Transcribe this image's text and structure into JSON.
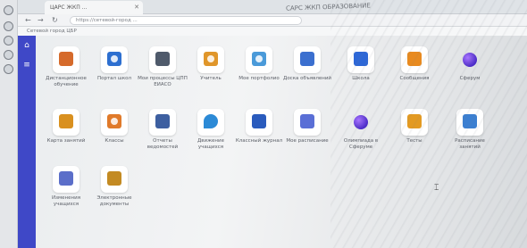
{
  "browser": {
    "tab_title": "ЦАРС ЖКП ...",
    "window_title": "САРС ЖКП ОБРАЗОВАНИЕ",
    "address": "https://сетевой-город ...",
    "bookmarks": "Сетевой город ЦБР"
  },
  "tiles": [
    {
      "label": "Дистанционное обучение",
      "color": "#d56a2b"
    },
    {
      "label": "Портал школ",
      "color": "#2d6fd0"
    },
    {
      "label": "Мои процессы ЦПП ЕИАСО",
      "color": "#4f5a6b"
    },
    {
      "label": "Учитель",
      "color": "#e0962a"
    },
    {
      "label": "Мое портфолио",
      "color": "#4a9ad9"
    },
    {
      "label": "Доска объявлений",
      "color": "#3b6fcf"
    },
    {
      "label": "Школа",
      "color": "#2d67d6"
    },
    {
      "label": "Сообщения",
      "color": "#e88a1f"
    },
    {
      "label": "Сферум",
      "color": "#6a3ad6"
    },
    {
      "label": "Карта занятий",
      "color": "#d9901f"
    },
    {
      "label": "Классы",
      "color": "#e07a2a"
    },
    {
      "label": "Отчеты ведомостей",
      "color": "#3d5fa0"
    },
    {
      "label": "Движение учащихся",
      "color": "#2c8ad6"
    },
    {
      "label": "Классный журнал",
      "color": "#2a5bbd"
    },
    {
      "label": "Мое расписание",
      "color": "#5a6fd6"
    },
    {
      "label": "Олимпиада в Сферуме",
      "color": "#6a3ad6"
    },
    {
      "label": "Тесты",
      "color": "#e39a22"
    },
    {
      "label": "Расписание занятий",
      "color": "#3b7fd1"
    },
    {
      "label": "Изменения учащихся",
      "color": "#5b6ec9"
    },
    {
      "label": "Электронные документы",
      "color": "#c38a22"
    }
  ]
}
